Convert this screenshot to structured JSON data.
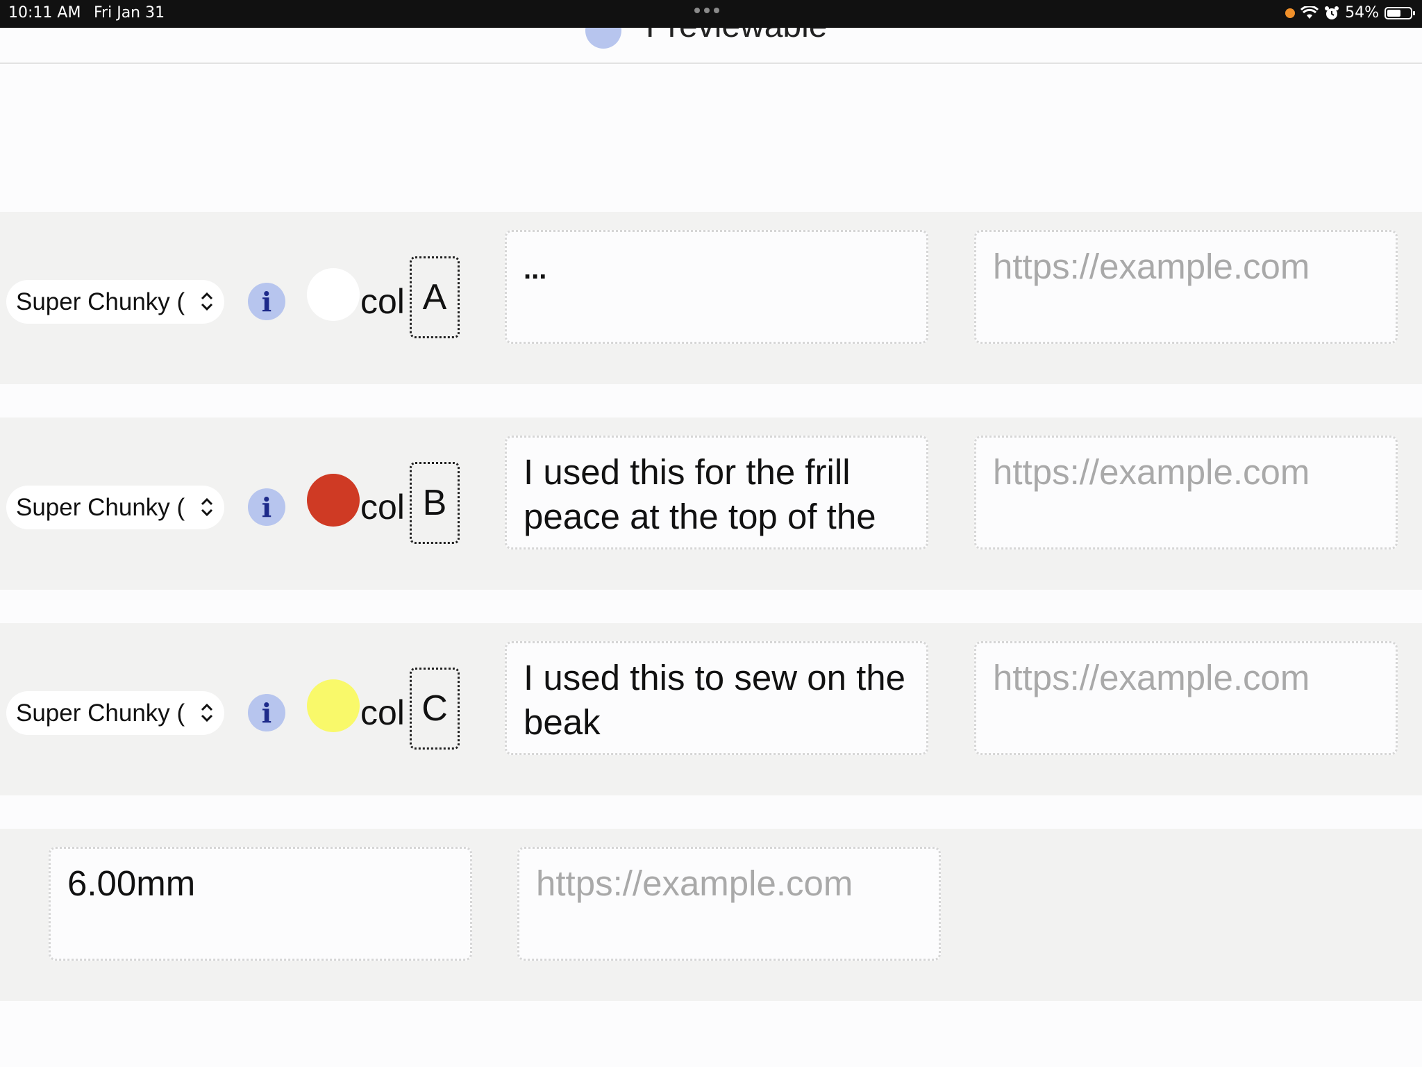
{
  "status_bar": {
    "time": "10:11 AM",
    "date": "Fri Jan 31",
    "battery": "54%",
    "battery_level": 0.54
  },
  "header": {
    "title": "Previewable"
  },
  "rows": [
    {
      "select_label": "Super Chunky (",
      "info_label": "i",
      "swatch_color": "#ffffff",
      "col_label": "col",
      "letter": "A",
      "note": "...",
      "url_placeholder": "https://example.com"
    },
    {
      "select_label": "Super Chunky (",
      "info_label": "i",
      "swatch_color": "#cf3a24",
      "col_label": "col",
      "letter": "B",
      "note": "I used this for the frill peace at the top of the head",
      "url_placeholder": "https://example.com"
    },
    {
      "select_label": "Super Chunky (",
      "info_label": "i",
      "swatch_color": "#f9f96a",
      "col_label": "col",
      "letter": "C",
      "note": "I used this to sew on the beak",
      "url_placeholder": "https://example.com"
    }
  ],
  "hook_row": {
    "size_value": "6.00mm",
    "url_placeholder": "https://example.com"
  },
  "colors": {
    "row_bg": "#f2f2f1",
    "info_bg": "#b7c5ee",
    "info_fg": "#1d2a8a",
    "placeholder": "#a9a9a9"
  }
}
